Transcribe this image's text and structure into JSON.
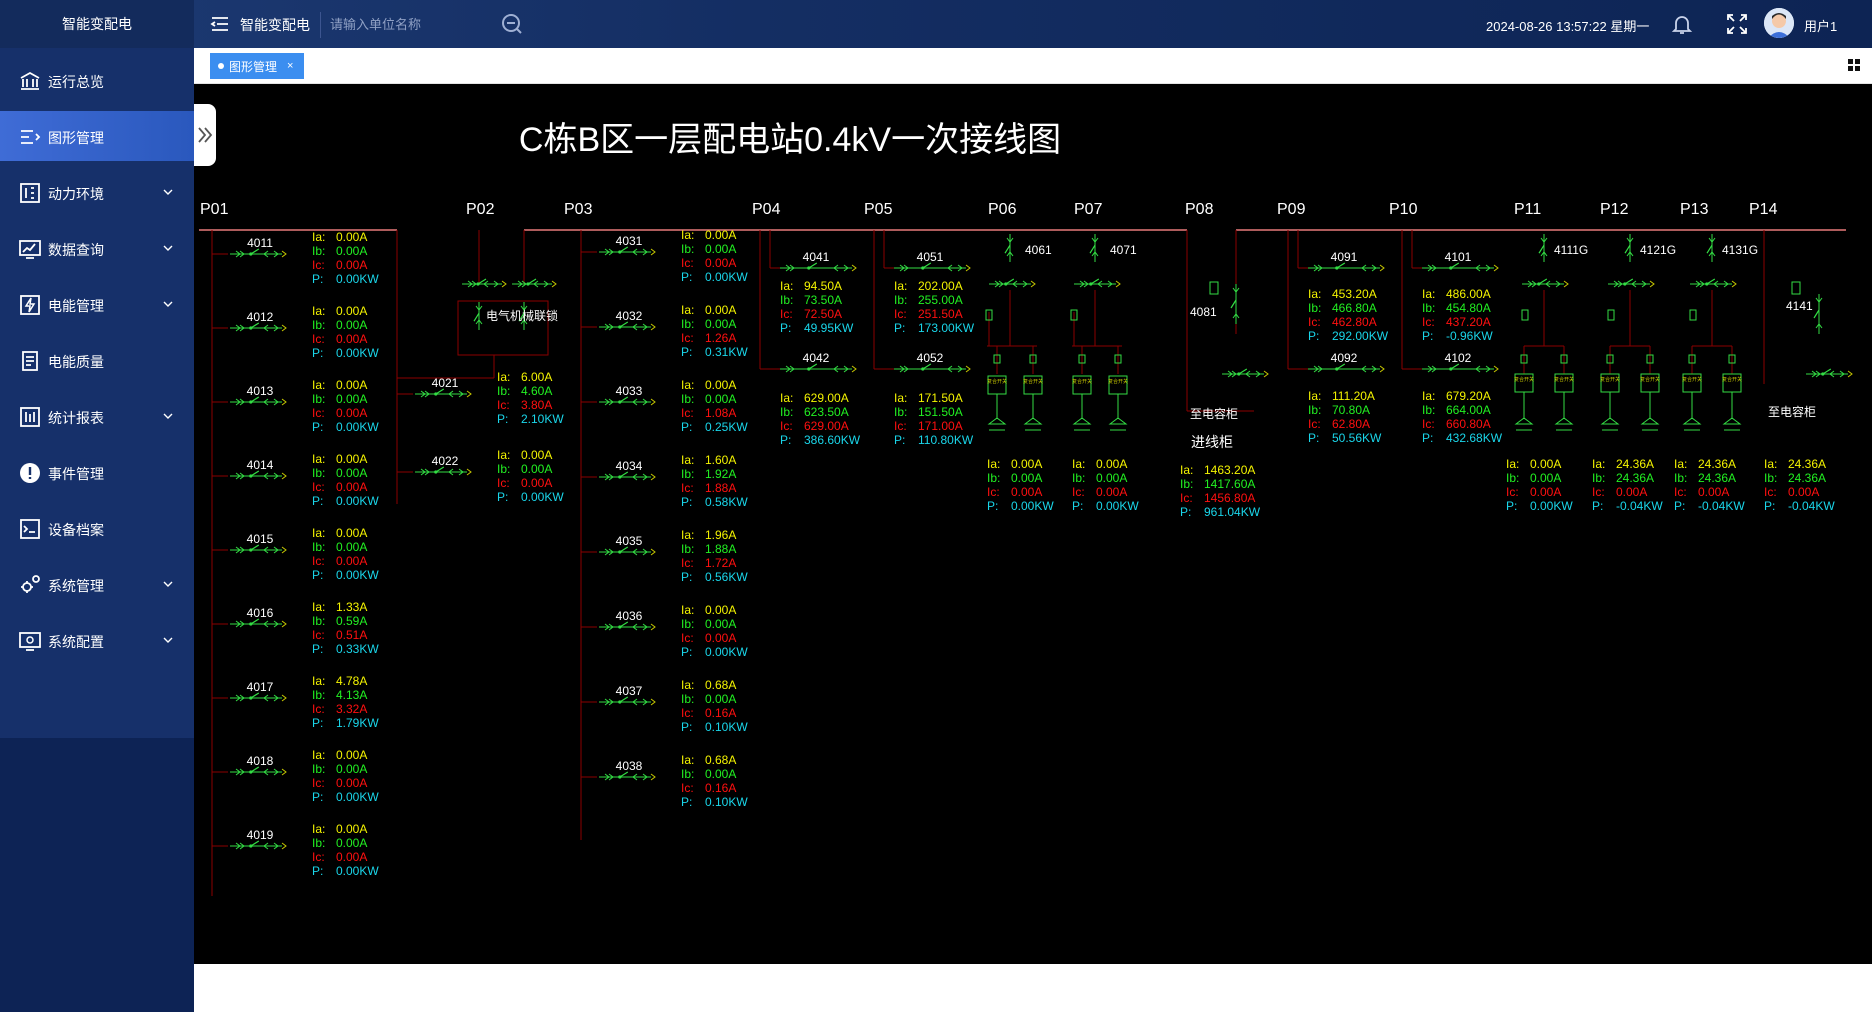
{
  "header": {
    "app_name": "智能变配电",
    "system_name": "智能变配电",
    "search_placeholder": "请输入单位名称",
    "datetime": "2024-08-26 13:57:22 星期一",
    "username": "用户1",
    "icons": [
      "menu-icon",
      "search-icon",
      "bell-icon",
      "fullscreen-icon",
      "avatar"
    ]
  },
  "sidebar": {
    "items": [
      {
        "label": "运行总览",
        "icon": "bank-icon",
        "expandable": false,
        "active": false
      },
      {
        "label": "图形管理",
        "icon": "list-icon",
        "expandable": false,
        "active": true
      },
      {
        "label": "动力环境",
        "icon": "panel-icon",
        "expandable": true,
        "active": false
      },
      {
        "label": "数据查询",
        "icon": "chart-icon",
        "expandable": true,
        "active": false
      },
      {
        "label": "电能管理",
        "icon": "energy-icon",
        "expandable": true,
        "active": false
      },
      {
        "label": "电能质量",
        "icon": "document-icon",
        "expandable": false,
        "active": false
      },
      {
        "label": "统计报表",
        "icon": "report-icon",
        "expandable": true,
        "active": false
      },
      {
        "label": "事件管理",
        "icon": "alert-icon",
        "expandable": false,
        "active": false
      },
      {
        "label": "设备档案",
        "icon": "device-icon",
        "expandable": false,
        "active": false
      },
      {
        "label": "系统管理",
        "icon": "gear-icon",
        "expandable": true,
        "active": false
      },
      {
        "label": "系统配置",
        "icon": "config-icon",
        "expandable": true,
        "active": false
      }
    ]
  },
  "tabs": [
    {
      "label": "图形管理",
      "close": "×",
      "active": true
    }
  ],
  "diagram": {
    "title": "C栋B区一层配电站0.4kV一次接线图",
    "colors": {
      "ia": "#f4f400",
      "ib": "#22f022",
      "ic": "#ff1010",
      "p": "#1ad6ea",
      "bus": "#e77b7b",
      "line": "#8b0000",
      "switch": "#33dd44",
      "label": "#ffffff"
    },
    "value_labels": {
      "ia": "Ia:",
      "ib": "Ib:",
      "ic": "Ic:",
      "p": "P:"
    },
    "panels": [
      "P01",
      "P02",
      "P03",
      "P04",
      "P05",
      "P06",
      "P07",
      "P08",
      "P09",
      "P10",
      "P11",
      "P12",
      "P13",
      "P14"
    ],
    "interlock_label": "电气机械联锁",
    "feeders": [
      {
        "id": "4011",
        "ia": "0.00A",
        "ib": "0.00A",
        "ic": "0.00A",
        "p": "0.00KW"
      },
      {
        "id": "4012",
        "ia": "0.00A",
        "ib": "0.00A",
        "ic": "0.00A",
        "p": "0.00KW"
      },
      {
        "id": "4013",
        "ia": "0.00A",
        "ib": "0.00A",
        "ic": "0.00A",
        "p": "0.00KW"
      },
      {
        "id": "4014",
        "ia": "0.00A",
        "ib": "0.00A",
        "ic": "0.00A",
        "p": "0.00KW"
      },
      {
        "id": "4015",
        "ia": "0.00A",
        "ib": "0.00A",
        "ic": "0.00A",
        "p": "0.00KW"
      },
      {
        "id": "4016",
        "ia": "1.33A",
        "ib": "0.59A",
        "ic": "0.51A",
        "p": "0.33KW"
      },
      {
        "id": "4017",
        "ia": "4.78A",
        "ib": "4.13A",
        "ic": "3.32A",
        "p": "1.79KW"
      },
      {
        "id": "4018",
        "ia": "0.00A",
        "ib": "0.00A",
        "ic": "0.00A",
        "p": "0.00KW"
      },
      {
        "id": "4019",
        "ia": "0.00A",
        "ib": "0.00A",
        "ic": "0.00A",
        "p": "0.00KW"
      },
      {
        "id": "4021",
        "ia": "6.00A",
        "ib": "4.60A",
        "ic": "3.80A",
        "p": "2.10KW"
      },
      {
        "id": "4022",
        "ia": "0.00A",
        "ib": "0.00A",
        "ic": "0.00A",
        "p": "0.00KW"
      },
      {
        "id": "4031",
        "ia": "0.00A",
        "ib": "0.00A",
        "ic": "0.00A",
        "p": "0.00KW"
      },
      {
        "id": "4032",
        "ia": "0.00A",
        "ib": "0.00A",
        "ic": "1.26A",
        "p": "0.31KW"
      },
      {
        "id": "4033",
        "ia": "0.00A",
        "ib": "0.00A",
        "ic": "1.08A",
        "p": "0.25KW"
      },
      {
        "id": "4034",
        "ia": "1.60A",
        "ib": "1.92A",
        "ic": "1.88A",
        "p": "0.58KW"
      },
      {
        "id": "4035",
        "ia": "1.96A",
        "ib": "1.88A",
        "ic": "1.72A",
        "p": "0.56KW"
      },
      {
        "id": "4036",
        "ia": "0.00A",
        "ib": "0.00A",
        "ic": "0.00A",
        "p": "0.00KW"
      },
      {
        "id": "4037",
        "ia": "0.68A",
        "ib": "0.00A",
        "ic": "0.16A",
        "p": "0.10KW"
      },
      {
        "id": "4038",
        "ia": "0.68A",
        "ib": "0.00A",
        "ic": "0.16A",
        "p": "0.10KW"
      },
      {
        "id": "4041",
        "ia": "94.50A",
        "ib": "73.50A",
        "ic": "72.50A",
        "p": "49.95KW"
      },
      {
        "id": "4042",
        "ia": "629.00A",
        "ib": "623.50A",
        "ic": "629.00A",
        "p": "386.60KW"
      },
      {
        "id": "4051",
        "ia": "202.00A",
        "ib": "255.00A",
        "ic": "251.50A",
        "p": "173.00KW"
      },
      {
        "id": "4052",
        "ia": "171.50A",
        "ib": "151.50A",
        "ic": "171.00A",
        "p": "110.80KW"
      },
      {
        "id": "4061",
        "ia": "0.00A",
        "ib": "0.00A",
        "ic": "0.00A",
        "p": "0.00KW"
      },
      {
        "id": "4071",
        "ia": "0.00A",
        "ib": "0.00A",
        "ic": "0.00A",
        "p": "0.00KW"
      },
      {
        "id": "4091",
        "ia": "453.20A",
        "ib": "466.80A",
        "ic": "462.80A",
        "p": "292.00KW"
      },
      {
        "id": "4092",
        "ia": "111.20A",
        "ib": "70.80A",
        "ic": "62.80A",
        "p": "50.56KW"
      },
      {
        "id": "4101",
        "ia": "486.00A",
        "ib": "454.80A",
        "ic": "437.20A",
        "p": "-0.96KW"
      },
      {
        "id": "4102",
        "ia": "679.20A",
        "ib": "664.00A",
        "ic": "660.80A",
        "p": "432.68KW"
      },
      {
        "id": "4111G",
        "ia": "0.00A",
        "ib": "0.00A",
        "ic": "0.00A",
        "p": "0.00KW"
      },
      {
        "id": "4121G",
        "ia": "24.36A",
        "ib": "24.36A",
        "ic": "0.00A",
        "p": "-0.04KW"
      },
      {
        "id": "4131G",
        "ia": "24.36A",
        "ib": "24.36A",
        "ic": "0.00A",
        "p": "-0.04KW"
      },
      {
        "id": "4141",
        "ia": "24.36A",
        "ib": "24.36A",
        "ic": "0.00A",
        "p": "-0.04KW"
      },
      {
        "id": "4081"
      }
    ],
    "incoming": {
      "label": "进线柜",
      "ia": "1463.20A",
      "ib": "1417.60A",
      "ic": "1456.80A",
      "p": "961.04KW"
    },
    "capacitor_label_1": "至电容柜",
    "capacitor_label_2": "至电容柜",
    "switch_box_label": "复合开关"
  }
}
